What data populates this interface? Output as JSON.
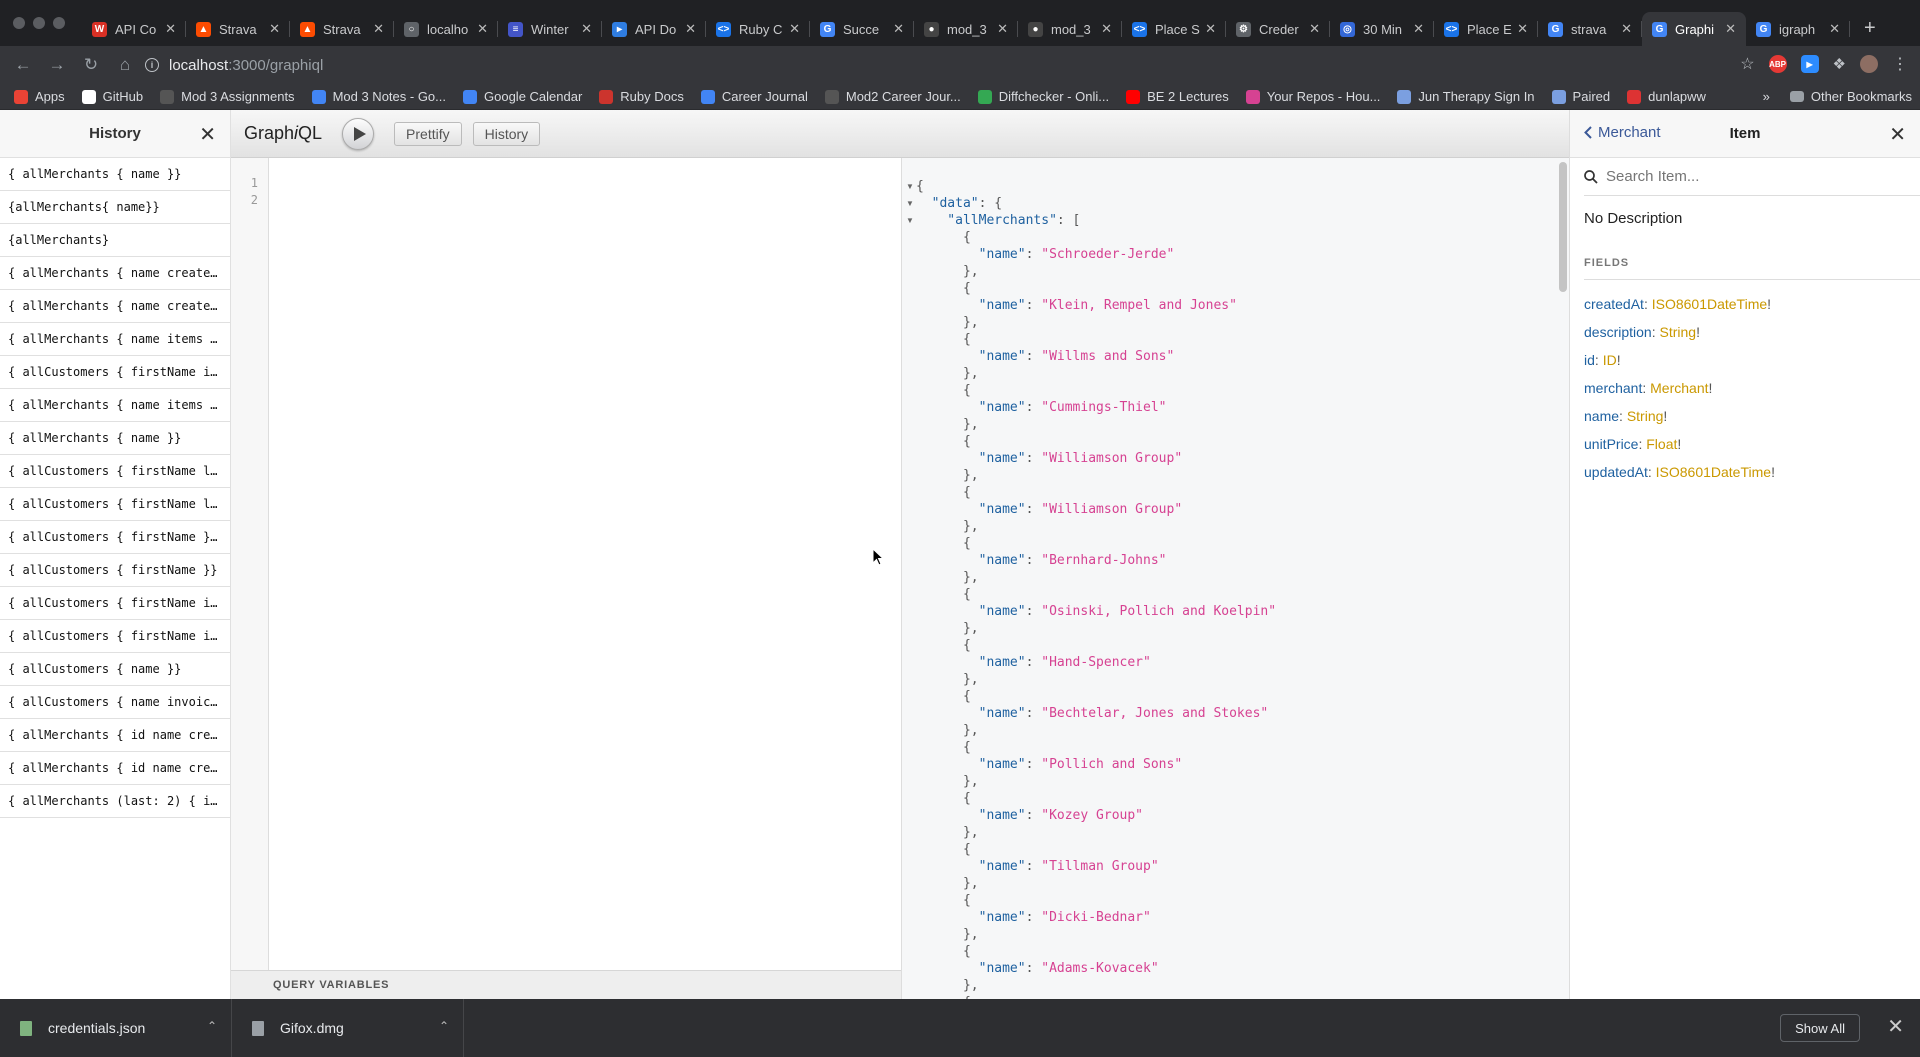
{
  "browser": {
    "tabs": [
      {
        "title": "API Co",
        "color": "#d93025",
        "glyph": "W"
      },
      {
        "title": "Strava",
        "color": "#fc4c02",
        "glyph": "▲"
      },
      {
        "title": "Strava",
        "color": "#fc4c02",
        "glyph": "▲"
      },
      {
        "title": "localho",
        "color": "#5f6368",
        "glyph": "○"
      },
      {
        "title": "Winter",
        "color": "#4355c8",
        "glyph": "≡"
      },
      {
        "title": "API Do",
        "color": "#2f7de1",
        "glyph": "▸"
      },
      {
        "title": "Ruby C",
        "color": "#1a73e8",
        "glyph": "<>"
      },
      {
        "title": "Succe",
        "color": "#4285f4",
        "glyph": "G"
      },
      {
        "title": "mod_3",
        "color": "#444",
        "glyph": "●"
      },
      {
        "title": "mod_3",
        "color": "#444",
        "glyph": "●"
      },
      {
        "title": "Place S",
        "color": "#1a73e8",
        "glyph": "<>"
      },
      {
        "title": "Creder",
        "color": "#5f6368",
        "glyph": "⚙"
      },
      {
        "title": "30 Min",
        "color": "#3367d6",
        "glyph": "◎"
      },
      {
        "title": "Place E",
        "color": "#1a73e8",
        "glyph": "<>"
      },
      {
        "title": "strava",
        "color": "#4285f4",
        "glyph": "G"
      },
      {
        "title": "Graphi",
        "color": "#4285f4",
        "glyph": "G",
        "active": true
      },
      {
        "title": "igraph",
        "color": "#4285f4",
        "glyph": "G"
      }
    ],
    "url_host": "localhost",
    "url_path": ":3000/graphiql",
    "bookmarks": [
      {
        "label": "Apps",
        "color": "#ea4335"
      },
      {
        "label": "GitHub",
        "color": "#ffffff"
      },
      {
        "label": "Mod 3 Assignments",
        "color": "#555"
      },
      {
        "label": "Mod 3 Notes - Go...",
        "color": "#4285f4"
      },
      {
        "label": "Google Calendar",
        "color": "#4285f4"
      },
      {
        "label": "Ruby Docs",
        "color": "#cc342d"
      },
      {
        "label": "Career Journal",
        "color": "#4285f4"
      },
      {
        "label": "Mod2 Career Jour...",
        "color": "#555"
      },
      {
        "label": "Diffchecker - Onli...",
        "color": "#34a853"
      },
      {
        "label": "BE 2 Lectures",
        "color": "#ff0000"
      },
      {
        "label": "Your Repos - Hou...",
        "color": "#d64292"
      },
      {
        "label": "Jun Therapy Sign In",
        "color": "#7b9fe0"
      },
      {
        "label": "Paired",
        "color": "#7b9fe0"
      },
      {
        "label": "dunlapww",
        "color": "#d33"
      }
    ],
    "other_bookmarks": "Other Bookmarks",
    "more_glyph": "»"
  },
  "history": {
    "title": "History",
    "items": [
      "{ allMerchants { name }}",
      "{allMerchants{ name}}",
      "{allMerchants}",
      "{ allMerchants { name create…",
      "{ allMerchants { name create…",
      "{ allMerchants { name items …",
      "{ allCustomers { firstName i…",
      "{ allMerchants { name items …",
      "{ allMerchants { name }}",
      "{ allCustomers { firstName l…",
      "{ allCustomers { firstName l…",
      "{ allCustomers { firstName }…",
      "{ allCustomers { firstName }}",
      "{ allCustomers { firstName i…",
      "{ allCustomers { firstName i…",
      "{ allCustomers { name }}",
      "{ allCustomers { name invoic…",
      "{ allMerchants { id name cre…",
      "{ allMerchants { id name cre…",
      "{ allMerchants (last: 2) { i…"
    ]
  },
  "toolbar": {
    "logo_prefix": "Graph",
    "logo_i": "i",
    "logo_suffix": "QL",
    "prettify": "Prettify",
    "history": "History"
  },
  "query_editor": {
    "line_numbers": [
      "1",
      "2"
    ],
    "query_variables_label": "QUERY VARIABLES"
  },
  "result": {
    "root_key": "data",
    "list_key": "allMerchants",
    "field_key": "name",
    "merchants": [
      "Schroeder-Jerde",
      "Klein, Rempel and Jones",
      "Willms and Sons",
      "Cummings-Thiel",
      "Williamson Group",
      "Williamson Group",
      "Bernhard-Johns",
      "Osinski, Pollich and Koelpin",
      "Hand-Spencer",
      "Bechtelar, Jones and Stokes",
      "Pollich and Sons",
      "Kozey Group",
      "Tillman Group",
      "Dicki-Bednar",
      "Adams-Kovacek"
    ]
  },
  "docs": {
    "back_label": "Merchant",
    "title": "Item",
    "search_placeholder": "Search Item...",
    "description": "No Description",
    "fields_heading": "FIELDS",
    "fields": [
      {
        "name": "createdAt",
        "type": "ISO8601DateTime"
      },
      {
        "name": "description",
        "type": "String"
      },
      {
        "name": "id",
        "type": "ID"
      },
      {
        "name": "merchant",
        "type": "Merchant"
      },
      {
        "name": "name",
        "type": "String"
      },
      {
        "name": "unitPrice",
        "type": "Float"
      },
      {
        "name": "updatedAt",
        "type": "ISO8601DateTime"
      }
    ],
    "name_color": "#1f61a0",
    "type_color": "#ca9800"
  },
  "downloads": {
    "items": [
      "credentials.json",
      "Gifox.dmg"
    ],
    "show_all": "Show All"
  }
}
